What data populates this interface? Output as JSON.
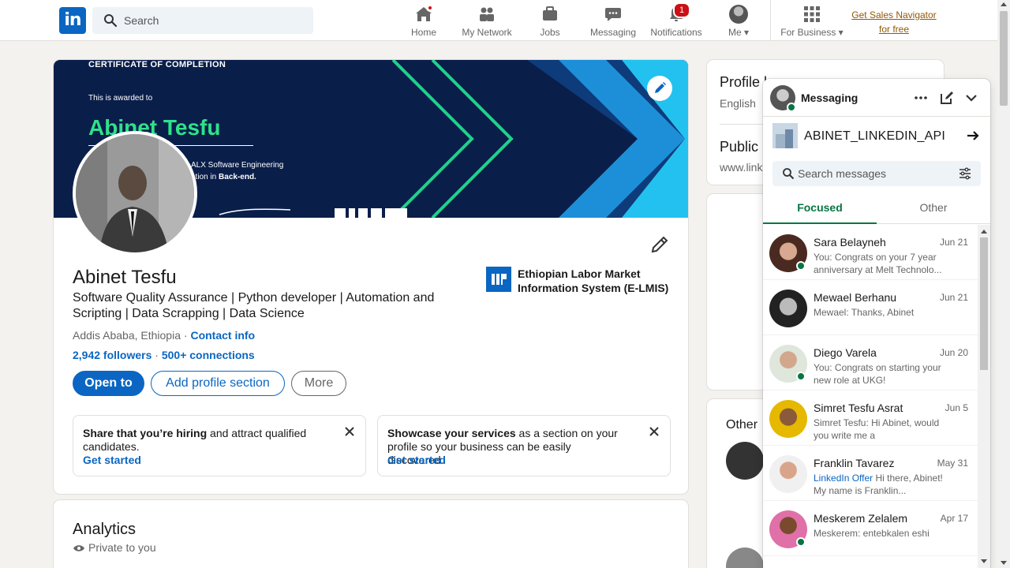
{
  "nav": {
    "logo": "in",
    "search_placeholder": "Search",
    "items": [
      {
        "label": "Home"
      },
      {
        "label": "My Network"
      },
      {
        "label": "Jobs"
      },
      {
        "label": "Messaging"
      },
      {
        "label": "Notifications",
        "badge": "1"
      },
      {
        "label": "Me"
      },
      {
        "label": "For Business"
      }
    ],
    "sales_line1": "Get Sales Navigator",
    "sales_line2": "for free"
  },
  "banner": {
    "cert_title": "CERTIFICATE OF COMPLETION",
    "cert_award": "This is awarded to",
    "cert_name": "Abinet Tesfu",
    "cert_program_1": "ALX Software Engineering",
    "cert_program_2a": "ation in ",
    "cert_program_2b": "Back-end."
  },
  "profile": {
    "name": "Abinet Tesfu",
    "headline": "Software Quality Assurance | Python developer | Automation and Scripting | Data Scrapping | Data Science",
    "location": "Addis Ababa, Ethiopia",
    "loc_sep": " · ",
    "contact": "Contact info",
    "followers": "2,942 followers",
    "stat_sep": " · ",
    "connections": "500+ connections",
    "btn_open": "Open to",
    "btn_add": "Add profile section",
    "btn_more": "More",
    "company": "Ethiopian Labor Market Information System (E-LMIS)"
  },
  "suggestions": [
    {
      "bold": "Share that you’re hiring",
      "rest": " and attract qualified candidates.",
      "cta": "Get started"
    },
    {
      "bold": "Showcase your services",
      "rest": " as a section on your profile so your business can be easily discovered.",
      "cta": "Get started"
    }
  ],
  "analytics": {
    "title": "Analytics",
    "sub": "Private to you"
  },
  "right": {
    "profile_lang": "Profile l",
    "lang": "English",
    "public": "Public",
    "url": "www.link",
    "other": "Other"
  },
  "messaging": {
    "title": "Messaging",
    "thread": "ABINET_LINKEDIN_API",
    "search_placeholder": "Search messages",
    "tab_focused": "Focused",
    "tab_other": "Other",
    "colors": {
      "accent_green": "#057642",
      "brand_blue": "#0a66c2"
    },
    "conversations": [
      {
        "name": "Sara Belayneh",
        "date": "Jun 21",
        "preview": "You: Congrats on your 7 year anniversary at Melt Technolo...",
        "online": true
      },
      {
        "name": "Mewael Berhanu",
        "date": "Jun 21",
        "preview": "Mewael: Thanks, Abinet",
        "online": false
      },
      {
        "name": "Diego Varela",
        "date": "Jun 20",
        "preview": "You: Congrats on starting your new role at UKG!",
        "online": true
      },
      {
        "name": "Simret Tesfu Asrat",
        "date": "Jun 5",
        "preview": "Simret Tesfu: Hi Abinet, would you write me a recommendatio...",
        "online": false
      },
      {
        "name": "Franklin Tavarez",
        "date": "May 31",
        "preview_tag": "LinkedIn Offer",
        "preview": "  Hi there, Abinet! My name is Franklin...",
        "online": false
      },
      {
        "name": "Meskerem Zelalem",
        "date": "Apr 17",
        "preview": "Meskerem: entebkalen eshi",
        "online": true
      }
    ]
  }
}
